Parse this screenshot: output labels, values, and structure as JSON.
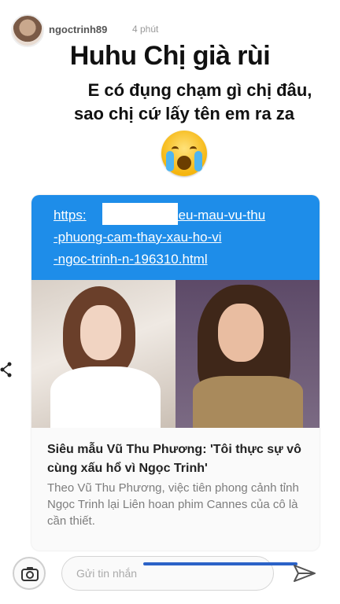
{
  "story": {
    "username": "ngoctrinh89",
    "time": "4 phút",
    "caption_title": "Huhu Chị già rùi",
    "caption_line1": "E có đụng chạm gì chị đâu,",
    "caption_line2": "sao chị cứ lấy tên em ra za",
    "emoji": "crying-face"
  },
  "article": {
    "url_line1_prefix": "https:",
    "url_line1_suffix": "/sieu-mau-vu-thu",
    "url_line2": "-phuong-cam-thay-xau-ho-vi",
    "url_line3": "-ngoc-trinh-n-196310.html",
    "headline": "Siêu mẫu Vũ Thu Phương: 'Tôi thực sự vô cùng xấu hổ vì Ngọc Trinh'",
    "excerpt": "Theo Vũ Thu Phương, việc tiên phong cảnh tỉnh Ngọc Trinh lại Liên hoan phim Cannes của cô là cần thiết."
  },
  "reply": {
    "placeholder": "Gửi tin nhắn",
    "progress": 0.45
  },
  "colors": {
    "url_box": "#1e8de9",
    "progress": "#2b62c7"
  }
}
